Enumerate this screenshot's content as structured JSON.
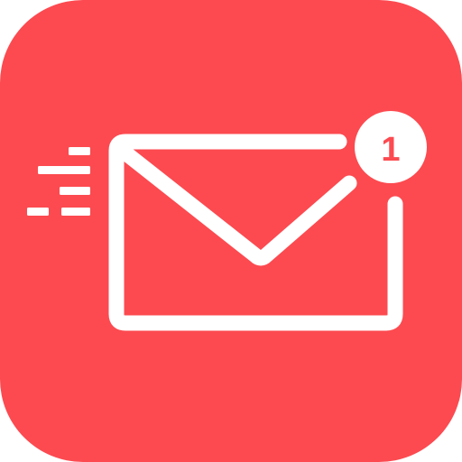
{
  "app_icon": {
    "name": "email-app",
    "background_color": "#fc4a50",
    "foreground_color": "#ffffff",
    "icons": [
      "envelope-icon",
      "speed-lines-icon",
      "notification-badge-icon"
    ],
    "notification_badge": {
      "count": "1"
    }
  }
}
